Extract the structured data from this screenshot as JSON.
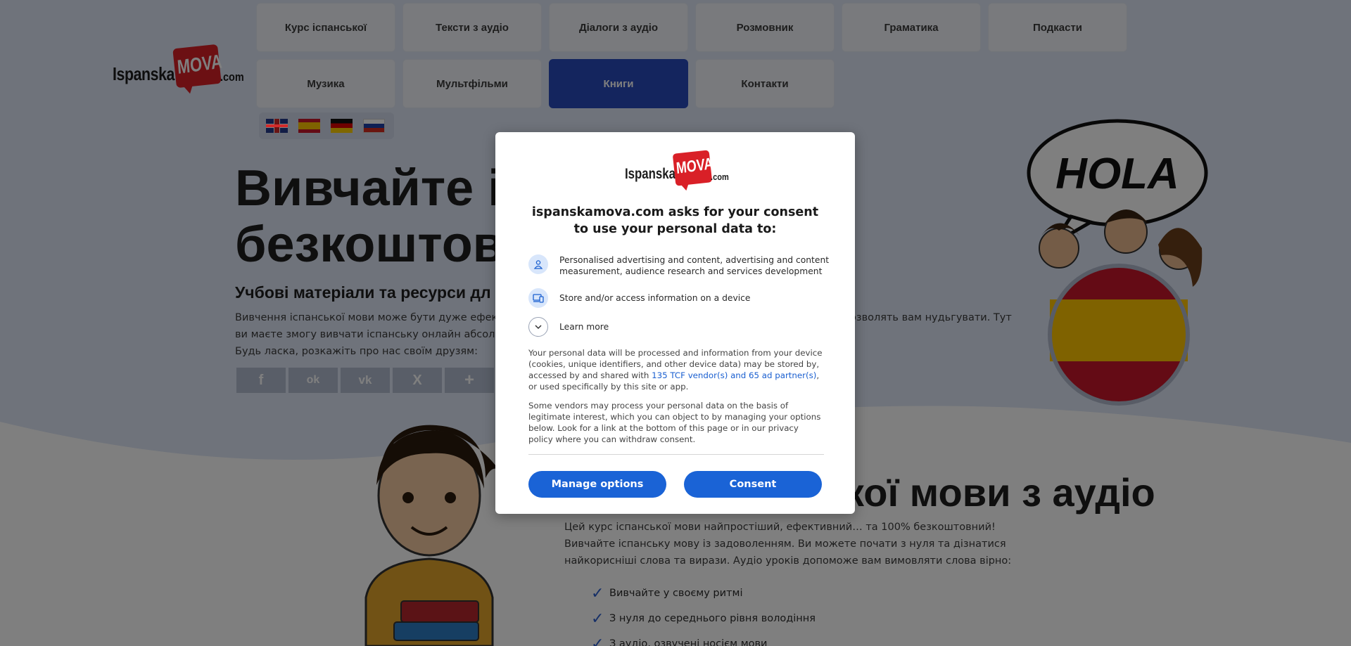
{
  "logo": {
    "part1": "Ispanska",
    "part2": "MOVA",
    "part3": ".com"
  },
  "nav": {
    "items": [
      {
        "label": "Курс іспанської"
      },
      {
        "label": "Тексти з аудіо"
      },
      {
        "label": "Діалоги з аудіо"
      },
      {
        "label": "Розмовник"
      },
      {
        "label": "Граматика"
      },
      {
        "label": "Подкасти"
      },
      {
        "label": "Музика"
      },
      {
        "label": "Мультфільми"
      },
      {
        "label": "Книги"
      },
      {
        "label": "Контакти"
      }
    ],
    "active": "Книги"
  },
  "languages": [
    "English",
    "Español",
    "Deutsch",
    "Русский"
  ],
  "hero": {
    "title": "Вивчайте і\nбезкоштов",
    "subtitle": "Учбові матеріали та ресурси дл",
    "body_line1": "Вивчення іспанської мови може бути дуже ефективни",
    "body_line1_right": "озволять вам нудьгувати. Тут",
    "body_line2": "ви маєте змогу вивчати іспанську онлайн абсолютно",
    "body_line3": "Будь ласка, розкажіть про нас своїм друзям:"
  },
  "share_icons": [
    "facebook-icon",
    "odnoklassniki-icon",
    "vk-icon",
    "x-icon",
    "plus-icon"
  ],
  "share_glyphs": [
    "f",
    "ok",
    "vk",
    "X",
    "+"
  ],
  "illustration": {
    "hola": "HOLA"
  },
  "section2": {
    "title": "кої мови з аудіо",
    "body": "Цей курс іспанської мови найпростіший, ефективний… та 100% безкоштовний! Вивчайте іспанську мову із задоволенням. Ви можете почати з нуля та дізнатися найкорисніші слова та вирази. Аудіо уроків допоможе вам вимовляти слова вірно:",
    "checks": [
      "Вивчайте у своєму ритмі",
      "З нуля до середнього рівня володіння",
      "З аудіо, озвучені носієм мови"
    ]
  },
  "consent": {
    "logo": {
      "part1": "Ispanska",
      "part2": "MOVA",
      "part3": ".com"
    },
    "title": "ispanskamova.com asks for your consent to use your personal data to:",
    "purposes": [
      {
        "icon": "person-icon",
        "text": "Personalised advertising and content, advertising and content measurement, audience research and services development"
      },
      {
        "icon": "device-icon",
        "text": "Store and/or access information on a device"
      }
    ],
    "learn_more": "Learn more",
    "para1_before": "Your personal data will be processed and information from your device (cookies, unique identifiers, and other device data) may be stored by, accessed by and shared with ",
    "para1_link": "135 TCF vendor(s) and 65 ad partner(s)",
    "para1_after": ", or used specifically by this site or app.",
    "para2": "Some vendors may process your personal data on the basis of legitimate interest, which you can object to by managing your options below. Look for a link at the bottom of this page or in our privacy policy where you can withdraw consent.",
    "manage_label": "Manage options",
    "consent_label": "Consent"
  },
  "colors": {
    "nav_active": "#294bbd",
    "consent_button": "#1a63d6",
    "link": "#1a5fd0",
    "logo_red": "#d92027"
  }
}
